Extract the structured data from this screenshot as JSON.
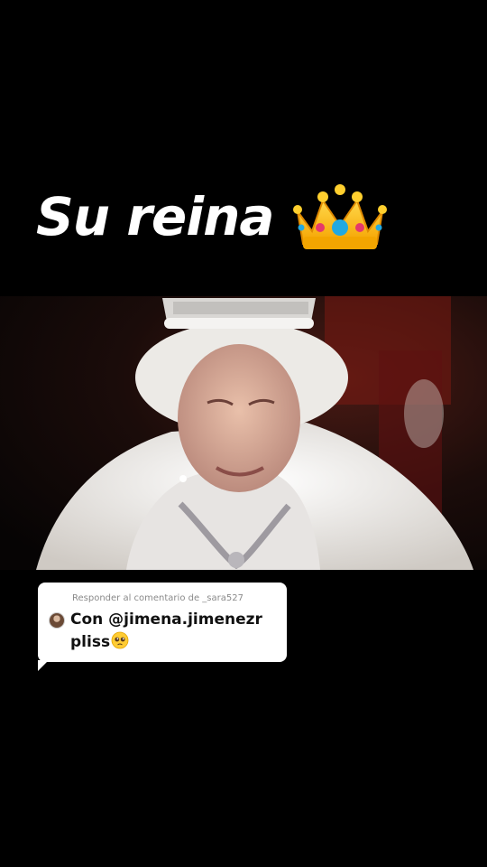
{
  "overlay": {
    "title": "Su reina",
    "title_emoji": "crown-icon"
  },
  "photo": {
    "subject": "photo-elderly-queen-in-crown-and-white-fur"
  },
  "reply": {
    "header": "Responder al comentario de _sara527",
    "line1": "Con @jimena.jimenezr",
    "line2": "pliss",
    "emoji": "pleading-face-icon"
  }
}
